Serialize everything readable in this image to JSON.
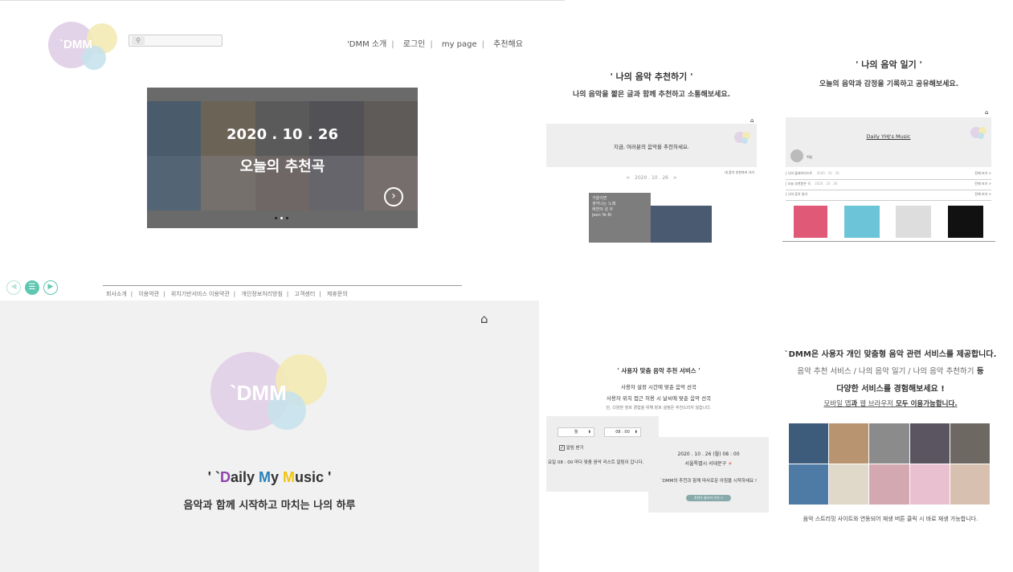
{
  "header": {
    "logo_text": "`DMM",
    "nav": [
      "'DMM 소개",
      "로그인",
      "my page",
      "추천해요"
    ]
  },
  "hero": {
    "date": "2020 . 10 . 26",
    "title": "오늘의 추천곡"
  },
  "footer": {
    "links": [
      "회사소개",
      "이용약관",
      "위치기반서비스 이용약관",
      "개인정보처리방침",
      "고객센터",
      "제휴문의"
    ]
  },
  "splash": {
    "logo_text": "`DMM",
    "tagline_quote_open": "' `",
    "tagline_d": "D",
    "tagline_aily": "aily ",
    "tagline_m1": "M",
    "tagline_y": "y ",
    "tagline_m2": "M",
    "tagline_usic": "usic '",
    "subtitle": "음악과 함께 시작하고 마치는 나의 하루"
  },
  "recommend": {
    "title": "' 나의 음악 추천하기 '",
    "desc": "나의 음악을 짧은 글과 함께 추천하고 소통해보세요.",
    "banner": "지금, 여러분의 음악을 추천하세요.",
    "date_nav": "<   2020 . 10 . 26   >",
    "link": "내 음악 추천하러 가기",
    "album_text": "가을이면\n생각나는 노래\n애연의 성 우\nJeon Ye Ri"
  },
  "diary": {
    "title": "' 나의 음악 일기 '",
    "desc": "오늘의 음악과 감정을 기록하고 공유해보세요.",
    "header": "Daily YHJ's Music",
    "user": "YHJ",
    "rows": [
      "| 나의 플레이리스트",
      "| 오늘 추천받은 곡",
      "| 나의 음악 일기"
    ],
    "row_dates": [
      "2020 . 10 . 26",
      "2020 . 10 . 26",
      ""
    ],
    "more": "전체 보기 >"
  },
  "service": {
    "title": "' 사용자 맞춤 음악 추천 서비스 '",
    "line1": "사용자 설정 시간에 맞춘 음악 선곡",
    "line2": "사용자 위치 접근 허용 시 날씨에 맞춘 음악 선곡",
    "line3": "단, 다양한 장르 경험을 위해 장르 설정은 추천드리지 않습니다.",
    "day_select": "월",
    "time_select": "08 : 00",
    "checkbox_label": "알림 받기",
    "notice": "요일 08 : 00 마다 맞춤 음악 리스트 알림이 갑니다.",
    "card_date": "2020 . 10 . 26 (월)  08 : 00",
    "card_location": "서울특별시 서대문구",
    "card_msg": "`DMM의 추천과 함께 따사로운 아침을 시작하세요 !",
    "card_button": "추천곡 들으러 가기 >"
  },
  "about": {
    "line1": "`DMM은 사용자 개인 맞춤형 음악 관련 서비스를 제공합니다.",
    "line2_a": "음악 추천 서비스 / 나의 음악 일기 / 나의 음악 추천하기",
    "line2_b": " 등",
    "line3": "다양한 서비스를 경험해보세요 !",
    "line4_a": "모바일 앱",
    "line4_b": "과 ",
    "line4_c": "웹 브라우저",
    "line4_d": " 모두 이용가능합니다.",
    "caption": "음악 스트리밍 사이트와 연동되어 재생 버튼 클릭 시 바로 재생 가능합니다."
  },
  "colors": {
    "purple": "#e3d3e8",
    "yellow": "#f3eab4",
    "blue": "#c6e2ec",
    "teal": "#5fc7b0",
    "accent_purple": "#8e44ad",
    "accent_blue": "#2980b9",
    "accent_yellow": "#f1c40f"
  }
}
